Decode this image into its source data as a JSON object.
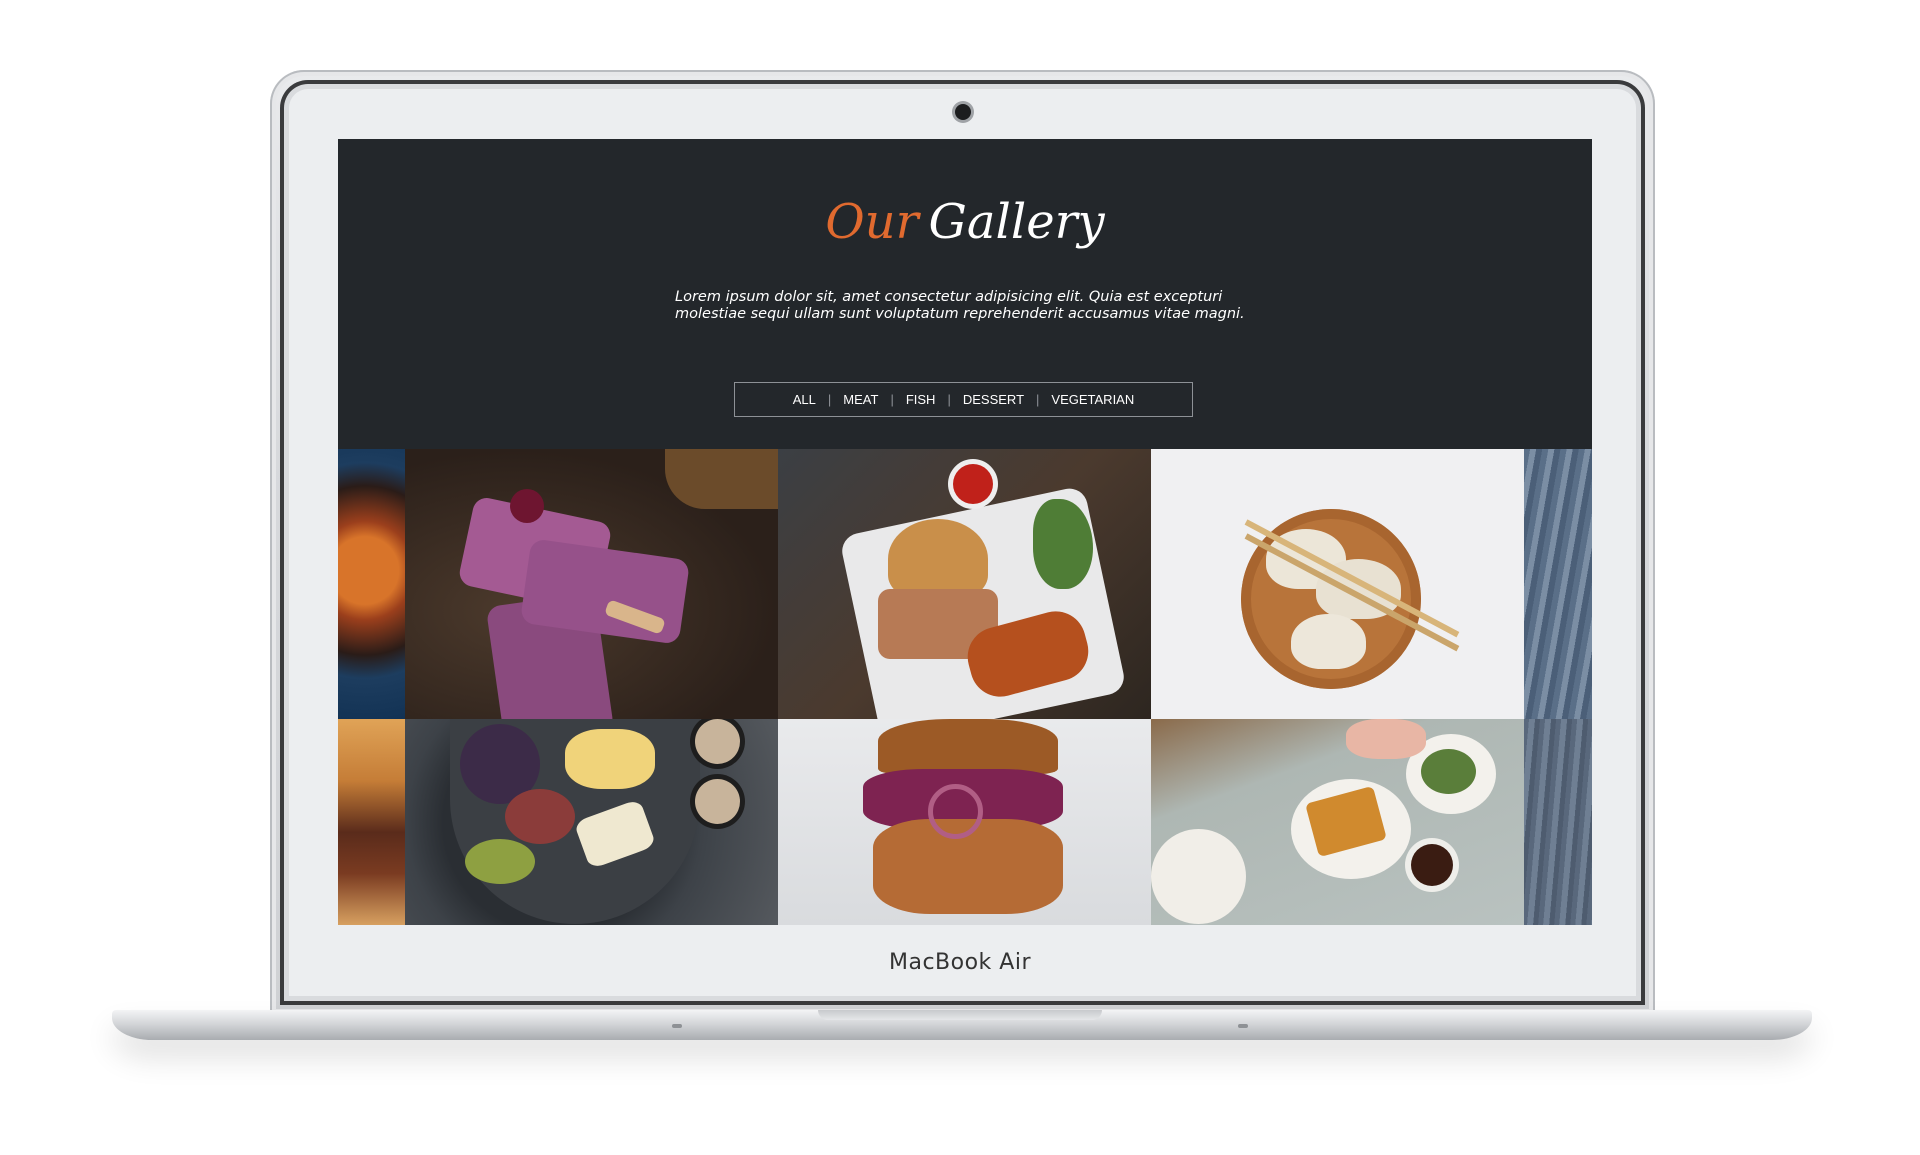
{
  "device": {
    "brand_label": "MacBook Air"
  },
  "gallery": {
    "title_accent": "Our",
    "title_main": "Gallery",
    "subtitle": "Lorem ipsum dolor sit, amet consectetur adipisicing elit. Quia est excepturi molestiae sequi ullam sunt voluptatum reprehenderit accusamus vitae magni.",
    "filters": [
      {
        "label": "ALL"
      },
      {
        "label": "MEAT"
      },
      {
        "label": "FISH"
      },
      {
        "label": "DESSERT"
      },
      {
        "label": "VEGETARIAN"
      }
    ],
    "images": [
      {
        "subject": "rice-dish"
      },
      {
        "subject": "berry-popsicles"
      },
      {
        "subject": "burger-and-fries"
      },
      {
        "subject": "dumplings"
      },
      {
        "subject": "cloth"
      },
      {
        "subject": "burger"
      },
      {
        "subject": "fig-platter"
      },
      {
        "subject": "fried-chicken-burger"
      },
      {
        "subject": "waffle-brunch"
      },
      {
        "subject": "wood-table"
      }
    ]
  },
  "colors": {
    "page_bg": "#23272b",
    "accent": "#e06a2f",
    "text": "#ffffff"
  }
}
